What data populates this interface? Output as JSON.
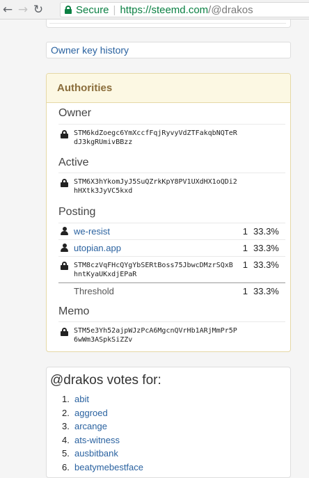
{
  "browser": {
    "secure_label": "Secure",
    "url_scheme_host": "https://steemd.com",
    "url_path": "/@drakos",
    "back_icon": "back-arrow-icon",
    "forward_icon": "forward-arrow-icon",
    "reload_icon": "reload-icon"
  },
  "owner_key_history": "Owner key history",
  "authorities": {
    "heading": "Authorities",
    "owner": {
      "title": "Owner",
      "key": "STM6kdZoegc6YmXccfFqjRyvyVdZTFakqbNQTeRdJ3kgRUmivBBzz"
    },
    "active": {
      "title": "Active",
      "key": "STM6X3hYkomJyJ5SuQZrkKpY8PV1UXdHX1oQDi2hHXtk3JyVC5kxd"
    },
    "posting": {
      "title": "Posting",
      "entries": [
        {
          "type": "account",
          "name": "we-resist",
          "weight": "1",
          "percent": "33.3%"
        },
        {
          "type": "account",
          "name": "utopian.app",
          "weight": "1",
          "percent": "33.3%"
        },
        {
          "type": "key",
          "name": "STM8czVqFHcQYgYbSERtBoss75JbwcDMzrSQxBhntKyaUKxdjEPaR",
          "weight": "1",
          "percent": "33.3%"
        }
      ],
      "threshold_label": "Threshold",
      "threshold_weight": "1",
      "threshold_percent": "33.3%"
    },
    "memo": {
      "title": "Memo",
      "key": "STM5e3Yh52ajpWJzPcA6MgcnQVrHb1ARjMmPr5P6wWm3ASpkSiZZv"
    }
  },
  "votes": {
    "title": "@drakos votes for:",
    "items": [
      {
        "num": "1.",
        "name": "abit"
      },
      {
        "num": "2.",
        "name": "aggroed"
      },
      {
        "num": "3.",
        "name": "arcange"
      },
      {
        "num": "4.",
        "name": "ats-witness"
      },
      {
        "num": "5.",
        "name": "ausbitbank"
      },
      {
        "num": "6.",
        "name": "beatymebestface"
      }
    ]
  }
}
